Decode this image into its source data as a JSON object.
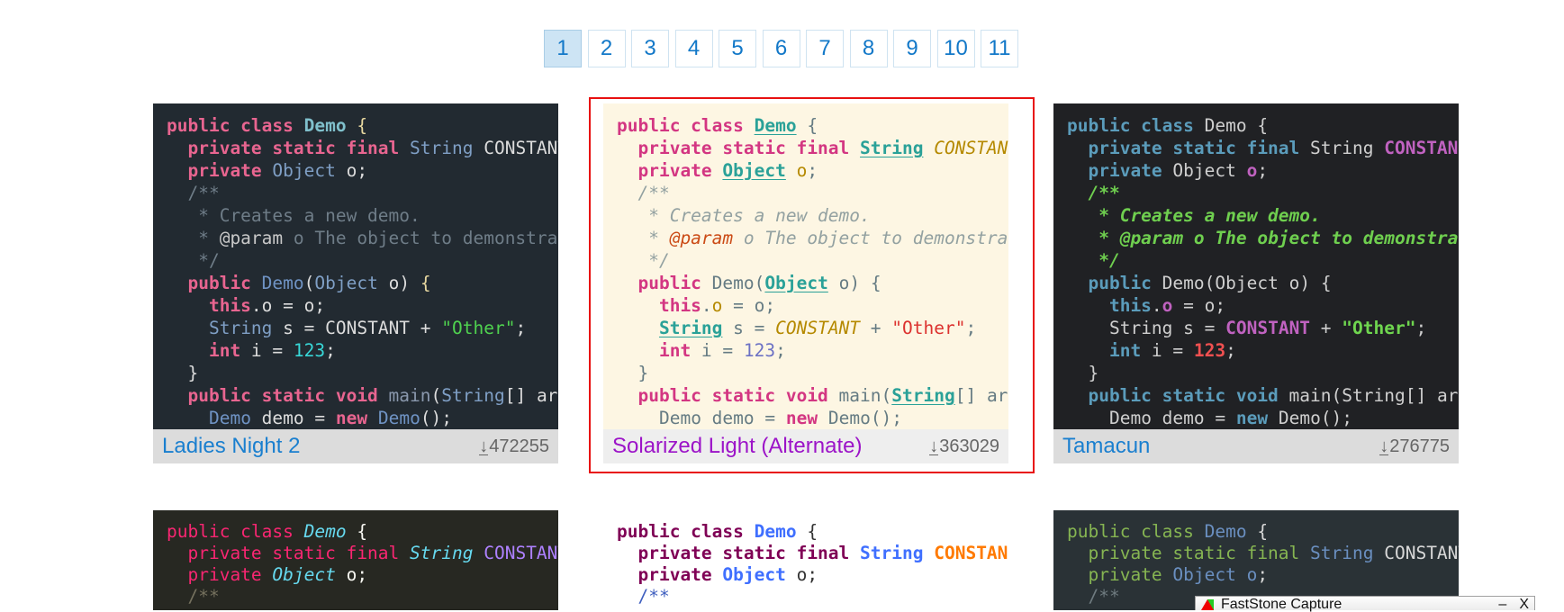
{
  "pagination": {
    "pages": [
      "1",
      "2",
      "3",
      "4",
      "5",
      "6",
      "7",
      "8",
      "9",
      "10",
      "11"
    ],
    "current": "1"
  },
  "code_lines": [
    [
      [
        "public class ",
        "kw"
      ],
      [
        "Demo",
        "cls"
      ],
      [
        " {",
        "punc"
      ]
    ],
    [
      [
        "  private static final ",
        "kw"
      ],
      [
        "String",
        "type"
      ],
      [
        " ",
        ""
      ],
      [
        "CONSTANT",
        "const"
      ]
    ],
    [
      [
        "  private ",
        "kw"
      ],
      [
        "Object",
        "type"
      ],
      [
        " ",
        ""
      ],
      [
        "o",
        "field"
      ],
      [
        ";",
        ""
      ]
    ],
    [
      [
        "  /**",
        "comment"
      ]
    ],
    [
      [
        "   * Creates a new demo.",
        "comment"
      ]
    ],
    [
      [
        "   * ",
        "comment"
      ],
      [
        "@param",
        "tag"
      ],
      [
        " o The object to demonstrate",
        "comment"
      ]
    ],
    [
      [
        "   */",
        "comment"
      ]
    ],
    [
      [
        "  public ",
        "kw"
      ],
      [
        "Demo",
        "ctor"
      ],
      [
        "(",
        ""
      ],
      [
        "Object",
        "type"
      ],
      [
        " o) ",
        ""
      ],
      [
        "{",
        "punc"
      ]
    ],
    [
      [
        "    this",
        "kw"
      ],
      [
        ".",
        ""
      ],
      [
        "o",
        "field"
      ],
      [
        " = o;",
        ""
      ]
    ],
    [
      [
        "    ",
        ""
      ],
      [
        "String",
        "type"
      ],
      [
        " s = ",
        ""
      ],
      [
        "CONSTANT",
        "const"
      ],
      [
        " + ",
        ""
      ],
      [
        "\"Other\"",
        "str"
      ],
      [
        ";",
        ""
      ]
    ],
    [
      [
        "    int",
        "kw"
      ],
      [
        " i = ",
        ""
      ],
      [
        "123",
        "num"
      ],
      [
        ";",
        ""
      ]
    ],
    [
      [
        "  }",
        ""
      ]
    ],
    [
      [
        "  public static void ",
        "kw"
      ],
      [
        "main",
        "fn"
      ],
      [
        "(",
        ""
      ],
      [
        "String",
        "type"
      ],
      [
        "[] args",
        ""
      ]
    ],
    [
      [
        "    ",
        ""
      ],
      [
        "Demo",
        "ctor"
      ],
      [
        " demo = ",
        ""
      ],
      [
        "new",
        "kw"
      ],
      [
        " ",
        ""
      ],
      [
        "Demo",
        "ctor"
      ],
      [
        "();",
        ""
      ]
    ]
  ],
  "themes": [
    {
      "name": "Ladies Night 2",
      "downloads": "472255"
    },
    {
      "name": "Solarized Light (Alternate)",
      "downloads": "363029",
      "selected": true
    },
    {
      "name": "Tamacun",
      "downloads": "276775"
    }
  ],
  "download_icon": "download-arrow-icon",
  "selection_color": "#e81010",
  "faststone": {
    "title": "FastStone Capture",
    "minimize": "–",
    "close": "X"
  }
}
